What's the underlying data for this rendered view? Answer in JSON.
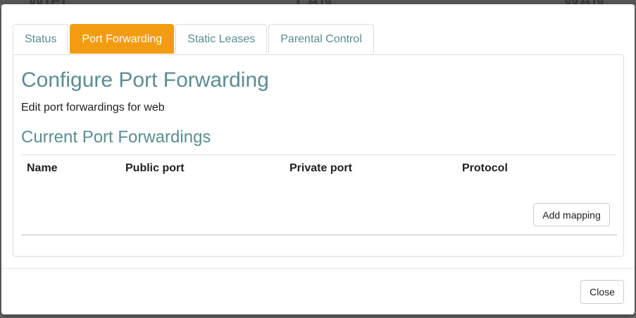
{
  "background": {
    "fragments": [
      "WIFI",
      "LAN",
      "WAN"
    ]
  },
  "tabs": [
    {
      "label": "Status",
      "active": false
    },
    {
      "label": "Port Forwarding",
      "active": true
    },
    {
      "label": "Static Leases",
      "active": false
    },
    {
      "label": "Parental Control",
      "active": false
    }
  ],
  "panel": {
    "title": "Configure Port Forwarding",
    "description": "Edit port forwardings for web",
    "section_title": "Current Port Forwardings",
    "table": {
      "columns": [
        "Name",
        "Public port",
        "Private port",
        "Protocol"
      ],
      "rows": []
    },
    "add_label": "Add mapping"
  },
  "footer": {
    "close_label": "Close"
  },
  "colors": {
    "accent": "#f39c12",
    "heading": "#5a8d93"
  }
}
